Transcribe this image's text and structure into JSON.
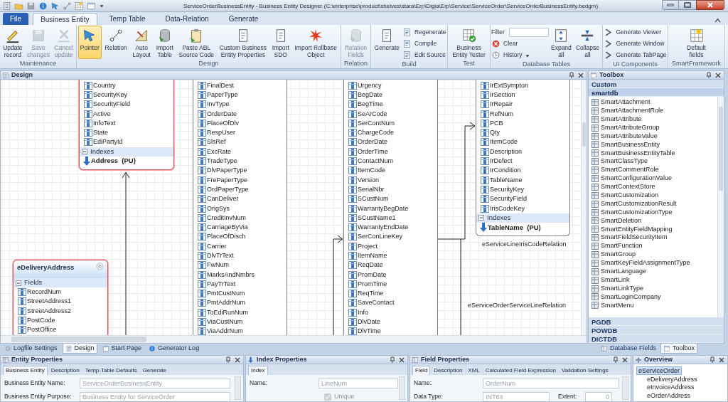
{
  "window": {
    "title": "ServiceOrderBusinessEntity - Business Entity Designer (C:\\enterprise\\product\\shelves\\stara\\Erp\\Digia\\Erp\\Service\\ServiceOrder\\ServiceOrderBusinessEntity.bedgm)"
  },
  "ribbon_tabs": [
    {
      "label": "File",
      "kind": "file",
      "selected": false
    },
    {
      "label": "Business Entity",
      "kind": "tab",
      "selected": true
    },
    {
      "label": "Temp Table",
      "kind": "tab",
      "selected": false
    },
    {
      "label": "Data-Relation",
      "kind": "tab",
      "selected": false
    },
    {
      "label": "Generate",
      "kind": "tab",
      "selected": false
    }
  ],
  "ribbon_groups": [
    {
      "label": "Maintenance",
      "items": [
        {
          "kind": "large",
          "label": "Update\nrecord",
          "selected": false,
          "disabled": false
        },
        {
          "kind": "large",
          "label": "Save\nchanges",
          "selected": false,
          "disabled": true
        },
        {
          "kind": "large",
          "label": "Cancel\nupdate",
          "selected": false,
          "disabled": true
        }
      ]
    },
    {
      "label": "Design",
      "items": [
        {
          "kind": "large",
          "label": "Pointer",
          "selected": true,
          "disabled": false
        },
        {
          "kind": "large",
          "label": "Relation",
          "selected": false,
          "disabled": false
        },
        {
          "kind": "large",
          "label": "Auto\nLayout",
          "selected": false,
          "disabled": false
        },
        {
          "kind": "large",
          "label": "Import\nTable",
          "selected": false,
          "disabled": false
        },
        {
          "kind": "large",
          "label": "Paste ABL\nSource Code",
          "selected": false,
          "disabled": false
        },
        {
          "kind": "large",
          "label": "Custom Business\nEntity Properties",
          "selected": false,
          "disabled": false
        },
        {
          "kind": "large",
          "label": "Import\nSDO",
          "selected": false,
          "disabled": false
        },
        {
          "kind": "large",
          "label": "Import Rollbase\nObject",
          "selected": false,
          "disabled": false
        }
      ]
    },
    {
      "label": "Relation",
      "items": [
        {
          "kind": "large",
          "label": "Relation\nFields",
          "selected": false,
          "disabled": true
        }
      ]
    },
    {
      "label": "Build",
      "items": [
        {
          "kind": "large",
          "label": "Generate",
          "selected": false,
          "disabled": false
        },
        {
          "kind": "stack",
          "items": [
            {
              "kind": "small",
              "label": "Regenerate",
              "disabled": false
            },
            {
              "kind": "small",
              "label": "Compile",
              "disabled": false
            },
            {
              "kind": "small",
              "label": "Edit Source",
              "disabled": false
            }
          ]
        }
      ]
    },
    {
      "label": "Test",
      "items": [
        {
          "kind": "large",
          "label": "Business\nEntity Tester",
          "selected": false,
          "disabled": false
        }
      ]
    },
    {
      "label": "Database Tables",
      "items": [
        {
          "kind": "stack",
          "items": [
            {
              "kind": "filter",
              "label": "Filter",
              "disabled": false
            },
            {
              "kind": "small",
              "label": "Clear",
              "disabled": false
            },
            {
              "kind": "dropdown",
              "label": "History",
              "disabled": false
            }
          ]
        },
        {
          "kind": "large",
          "label": "Expand\nall",
          "selected": false,
          "disabled": false
        },
        {
          "kind": "large",
          "label": "Collapse\nall",
          "selected": false,
          "disabled": false
        }
      ]
    },
    {
      "label": "UI Components",
      "items": [
        {
          "kind": "stack",
          "items": [
            {
              "kind": "small",
              "label": "Generate Viewer",
              "disabled": false
            },
            {
              "kind": "small",
              "label": "Generate Window",
              "disabled": false
            },
            {
              "kind": "small",
              "label": "Generate TabPage",
              "disabled": false
            }
          ]
        }
      ]
    },
    {
      "label": "SmartFramework",
      "items": [
        {
          "kind": "large",
          "label": "Default\nfields",
          "selected": false,
          "disabled": false
        }
      ]
    }
  ],
  "design_panel": {
    "title": "Design"
  },
  "entities": [
    {
      "selected": true,
      "sections": [
        {
          "kind": "fields",
          "items": [
            "Country",
            "SecurityKey",
            "SecurityField",
            "Active",
            "InfoText",
            "State",
            "EdiPartyId"
          ]
        },
        {
          "kind": "indexes",
          "header": "Indexes",
          "items": [
            "Address  (PU)"
          ]
        }
      ]
    },
    {
      "selected": false,
      "sections": [
        {
          "kind": "fields",
          "items": [
            "FinalDest",
            "PaperType",
            "InvType",
            "OrderDate",
            "PlaceOfDlv",
            "RespUser",
            "SlsRef",
            "ExcRate",
            "TradeType",
            "DlvPaperType",
            "FrePaperType",
            "OrdPaperType",
            "CanDeliver",
            "OrigSys",
            "CreditInvNum",
            "CarriageByVia",
            "PlaceOfDisch",
            "Carrier",
            "DlvTrText",
            "FwNum",
            "MarksAndNmbrs",
            "PayTrText",
            "PmtCustNum",
            "PmtAddrNum",
            "ToEdiRunNum",
            "ViaCustNum",
            "ViaAddrNum"
          ]
        }
      ]
    },
    {
      "selected": false,
      "sections": [
        {
          "kind": "fields",
          "items": [
            "Urgency",
            "BegDate",
            "BegTime",
            "SeArCode",
            "SerContNum",
            "ChargeCode",
            "OrderDate",
            "OrderTime",
            "ContactNum",
            "ItemCode",
            "Version",
            "SerialNbr",
            "SCustNum",
            "WarrantyBegDate",
            "SCustName1",
            "WarrantyEndDate",
            "SerConLineKey",
            "Project",
            "ItemName",
            "ReqDate",
            "PromDate",
            "PromTime",
            "ReqTime",
            "SaveContact",
            "Info",
            "DlvDate",
            "DlvTime"
          ]
        }
      ]
    },
    {
      "selected": false,
      "sections": [
        {
          "kind": "fields",
          "items": [
            "IrExtSympton",
            "IrSection",
            "IrRepair",
            "RefNum",
            "PCB",
            "Qty",
            "ItemCode",
            "Description",
            "IrDefect",
            "IrCondition",
            "TableName",
            "SecurityKey",
            "SecurityField",
            "IrisCodeKey"
          ]
        },
        {
          "kind": "indexes",
          "header": "Indexes",
          "items": [
            "TableName  (PU)"
          ]
        }
      ]
    },
    {
      "title": "eDeliveryAddress",
      "selected": true,
      "sections": [
        {
          "kind": "fields",
          "header": "Fields",
          "items": [
            "RecordNum",
            "StreetAddress1",
            "StreetAddress2",
            "PostCode",
            "PostOffice"
          ]
        }
      ]
    }
  ],
  "relation_labels": [
    "eServiceLineIrisCodeRelation",
    "eServiceOrderServiceLineRelation"
  ],
  "toolbox": {
    "title": "Toolbox",
    "categories": [
      {
        "label": "Custom",
        "expanded": false
      },
      {
        "label": "smartdb",
        "expanded": true,
        "items": [
          "SmartAttachment",
          "SmartAttachmentRole",
          "SmartAttribute",
          "SmartAttributeGroup",
          "SmartAttributeValue",
          "SmartBusinessEntity",
          "SmartBusinessEntityTable",
          "SmartClassType",
          "SmartCommentRole",
          "SmartConfigurationValue",
          "SmartContextStore",
          "SmartCustomization",
          "SmartCustomizationResult",
          "SmartCustomizationType",
          "SmartDeletion",
          "SmartEntityFieldMapping",
          "SmartFieldSecurityItem",
          "SmartFunction",
          "SmartGroup",
          "SmartKeyFieldAssignmentType",
          "SmartLanguage",
          "SmartLink",
          "SmartLinkType",
          "SmartLoginCompany",
          "SmartMenu"
        ]
      },
      {
        "label": "PGDB",
        "expanded": false
      },
      {
        "label": "POWDB",
        "expanded": false
      },
      {
        "label": "DICTDB",
        "expanded": false
      }
    ],
    "tabs": [
      {
        "label": "Database Fields",
        "selected": false
      },
      {
        "label": "Toolbox",
        "selected": true
      }
    ]
  },
  "document_tabs": [
    {
      "label": "Logfile Settings",
      "selected": false
    },
    {
      "label": "Design",
      "selected": true
    },
    {
      "label": "Start Page",
      "selected": false
    },
    {
      "label": "Generator Log",
      "selected": false
    }
  ],
  "property_panels": [
    {
      "title": "Entity Properties",
      "tabs": [
        {
          "label": "Business Entity",
          "selected": true
        },
        {
          "label": "Description",
          "selected": false
        },
        {
          "label": "Temp-Table Defaults",
          "selected": false
        },
        {
          "label": "Generate",
          "selected": false
        }
      ],
      "rows": [
        [
          {
            "kind": "text",
            "label": "Business Entity Name:",
            "value": "ServiceOrderBusinessEntity",
            "disabled": true
          }
        ],
        [
          {
            "kind": "text",
            "label": "Business Entity Purpose:",
            "value": "Business Entity for ServiceOrder",
            "disabled": true
          }
        ]
      ]
    },
    {
      "title": "Index Properties",
      "tabs": [
        {
          "label": "Index",
          "selected": true
        }
      ],
      "rows": [
        [
          {
            "kind": "text",
            "label": "Name:",
            "value": "LineNum",
            "disabled": true
          }
        ],
        [
          {
            "kind": "checkbox",
            "label": "Unique",
            "checked": true,
            "disabled": true
          }
        ]
      ]
    },
    {
      "title": "Field Properties",
      "tabs": [
        {
          "label": "Field",
          "selected": true
        },
        {
          "label": "Description",
          "selected": false
        },
        {
          "label": "XML",
          "selected": false
        },
        {
          "label": "Calculated Field Expression",
          "selected": false
        },
        {
          "label": "Validation Settings",
          "selected": false
        }
      ],
      "rows": [
        [
          {
            "kind": "text",
            "label": "Name:",
            "value": "OrderNum",
            "disabled": true
          }
        ],
        [
          {
            "kind": "combo",
            "label": "Data Type:",
            "value": "INT64",
            "disabled": true
          },
          {
            "kind": "number",
            "label": "Extent:",
            "value": "0",
            "disabled": true
          }
        ]
      ]
    }
  ],
  "overview": {
    "title": "Overview",
    "tree": [
      {
        "label": "eServiceOrder",
        "selected": true,
        "children": [
          {
            "label": "eDeliveryAddress",
            "selected": false
          },
          {
            "label": "eInvoiceAddress",
            "selected": false
          },
          {
            "label": "eOrderAddress",
            "selected": false
          }
        ]
      }
    ]
  }
}
